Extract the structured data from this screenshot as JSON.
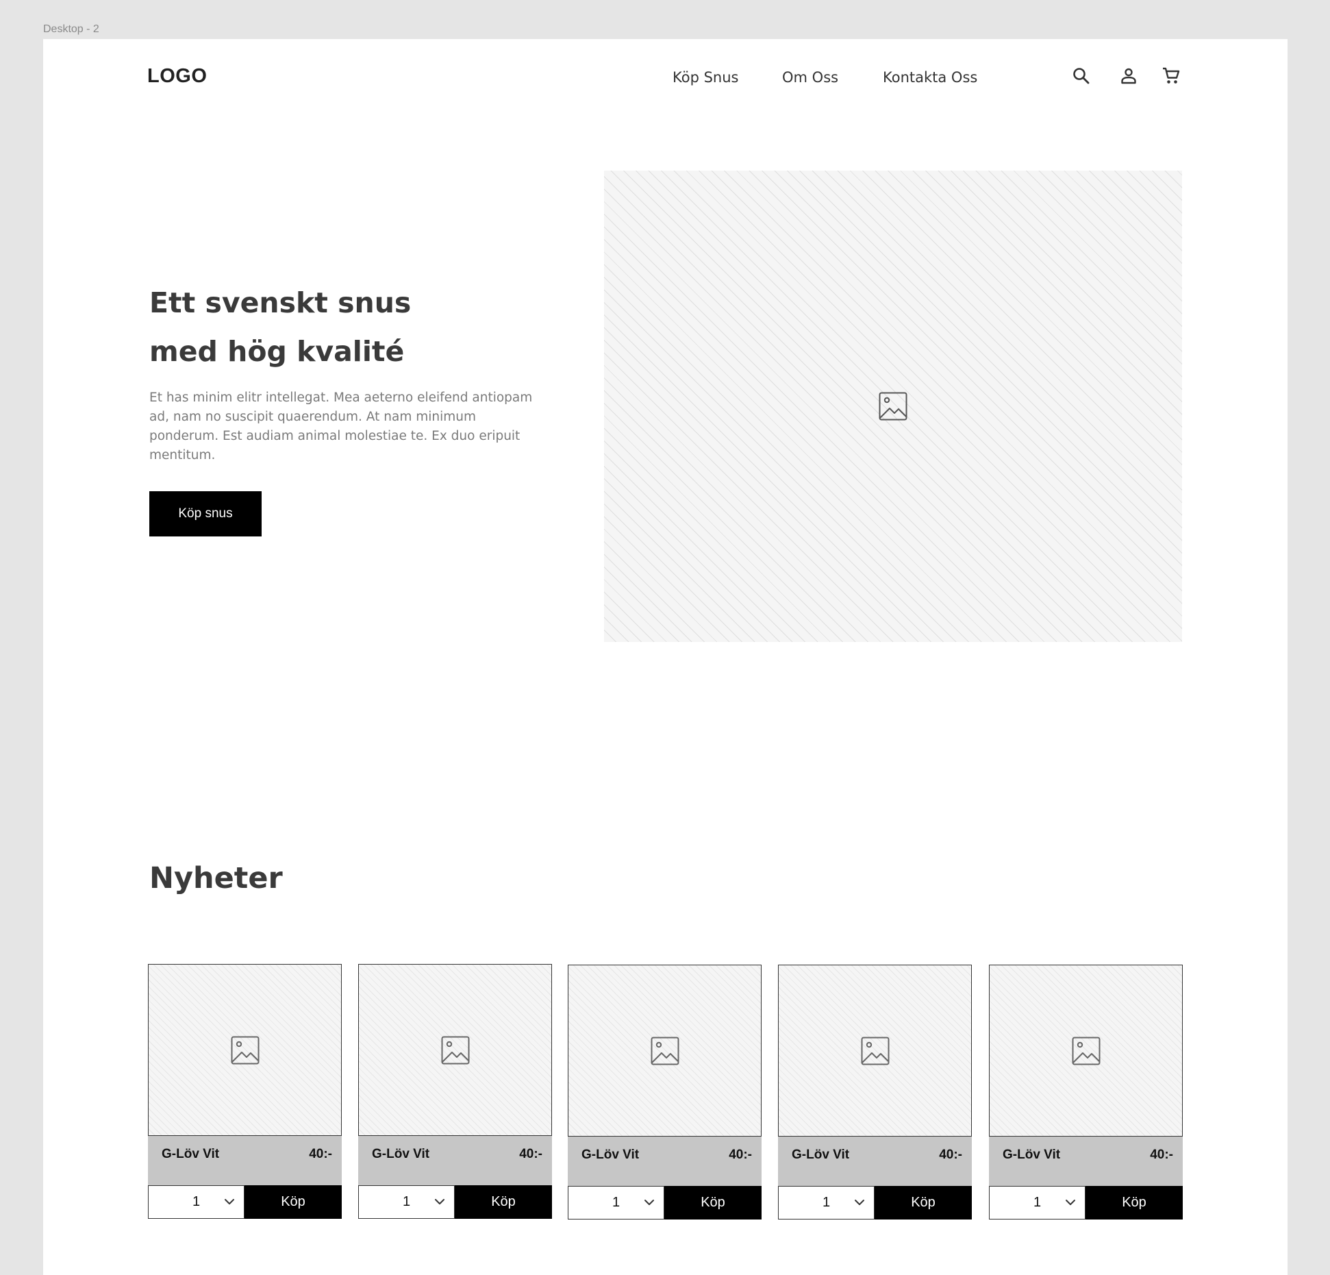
{
  "frame_label": "Desktop - 2",
  "header": {
    "logo": "LOGO",
    "nav": [
      {
        "label": "Köp Snus"
      },
      {
        "label": "Om Oss"
      },
      {
        "label": "Kontakta Oss"
      }
    ],
    "icons": [
      "search-icon",
      "user-icon",
      "cart-icon"
    ]
  },
  "hero": {
    "title_line1": "Ett svenskt snus",
    "title_line2": "med hög kvalité",
    "text": "Et has minim elitr intellegat. Mea aeterno eleifend antiopam ad, nam no suscipit quaerendum. At nam minimum ponderum. Est audiam animal molestiae te. Ex duo eripuit mentitum.",
    "cta": "Köp snus",
    "image_icon": "image-placeholder-icon"
  },
  "news": {
    "title": "Nyheter",
    "products": [
      {
        "name": "G-Löv Vit",
        "price": "40:-",
        "qty": "1",
        "buy": "Köp"
      },
      {
        "name": "G-Löv Vit",
        "price": "40:-",
        "qty": "1",
        "buy": "Köp"
      },
      {
        "name": "G-Löv Vit",
        "price": "40:-",
        "qty": "1",
        "buy": "Köp"
      },
      {
        "name": "G-Löv Vit",
        "price": "40:-",
        "qty": "1",
        "buy": "Köp"
      },
      {
        "name": "G-Löv Vit",
        "price": "40:-",
        "qty": "1",
        "buy": "Köp"
      }
    ]
  },
  "colors": {
    "background": "#e5e5e5",
    "canvas": "#ffffff",
    "button": "#000000",
    "product_info_bar": "#c6c6c6"
  }
}
